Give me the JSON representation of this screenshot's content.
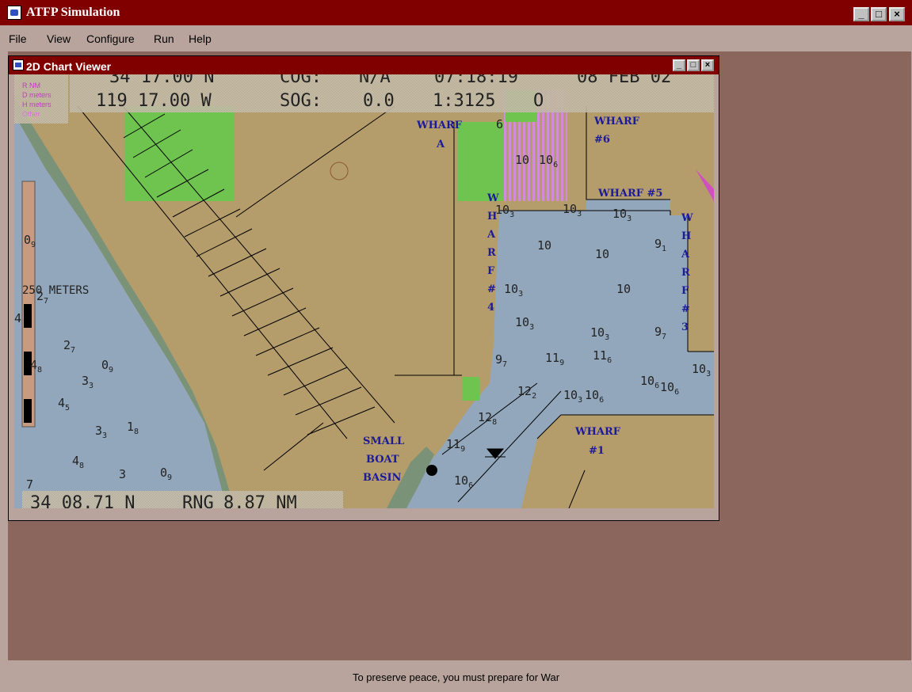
{
  "app": {
    "title": "ATFP Simulation",
    "window_controls": {
      "minimize": "_",
      "maximize": "□",
      "close": "×"
    }
  },
  "menu": {
    "items": [
      {
        "label": "File"
      },
      {
        "label": "View"
      },
      {
        "label": "Configure"
      },
      {
        "label": "Run"
      },
      {
        "label": "Help"
      }
    ]
  },
  "chart_viewer": {
    "title": "2D Chart Viewer",
    "window_controls": {
      "minimize": "_",
      "maximize": "□",
      "close": "×"
    },
    "readout": {
      "lat_top": "34 17.00 N",
      "lon": "119 17.00 W",
      "cog_label": "COG:",
      "cog_value": "N/A",
      "sog_label": "SOG:",
      "sog_value": "0.0",
      "time": "07:18:19",
      "date": "08 FEB 02",
      "scale": "1:3125",
      "scale_suffix": "O"
    },
    "legend": {
      "r": "R NM",
      "d": "D meters",
      "h": "H meters",
      "other": "Other"
    },
    "scale_bar_label": "250 METERS",
    "cursor_readout": {
      "lat": "34 08.71 N",
      "rng_label": "RNG",
      "rng_value": "8.87 NM"
    },
    "wharf_labels": {
      "a_line1": "WHARF",
      "a_line2": "A",
      "w6_line1": "WHARF",
      "w6_line2": "#6",
      "w5": "WHARF #5",
      "w4": [
        "W",
        "H",
        "A",
        "R",
        "F",
        "#",
        "4"
      ],
      "w3": [
        "W",
        "H",
        "A",
        "R",
        "F",
        "#",
        "3"
      ],
      "w1_line1": "WHARF",
      "w1_line2": "#1",
      "small_boat": [
        "SMALL",
        "BOAT",
        "BASIN"
      ]
    },
    "soundings": [
      {
        "t": "0",
        "s": "9"
      },
      {
        "t": "2",
        "s": "7"
      },
      {
        "t": "4",
        "s": ""
      },
      {
        "t": "2",
        "s": "7"
      },
      {
        "t": "4",
        "s": "8"
      },
      {
        "t": "0",
        "s": "9"
      },
      {
        "t": "3",
        "s": "3"
      },
      {
        "t": "4",
        "s": "5"
      },
      {
        "t": "3",
        "s": "3"
      },
      {
        "t": "1",
        "s": "8"
      },
      {
        "t": "4",
        "s": "8"
      },
      {
        "t": "3",
        "s": ""
      },
      {
        "t": "0",
        "s": "9"
      },
      {
        "t": "7",
        "s": ""
      },
      {
        "t": "6",
        "s": ""
      },
      {
        "t": "10",
        "s": ""
      },
      {
        "t": "10",
        "s": "6"
      },
      {
        "t": "10",
        "s": "3"
      },
      {
        "t": "10",
        "s": "3"
      },
      {
        "t": "10",
        "s": "3"
      },
      {
        "t": "10",
        "s": ""
      },
      {
        "t": "10",
        "s": ""
      },
      {
        "t": "9",
        "s": "1"
      },
      {
        "t": "10",
        "s": "3"
      },
      {
        "t": "10",
        "s": ""
      },
      {
        "t": "10",
        "s": "3"
      },
      {
        "t": "10",
        "s": "3"
      },
      {
        "t": "9",
        "s": "7"
      },
      {
        "t": "9",
        "s": "7"
      },
      {
        "t": "11",
        "s": "9"
      },
      {
        "t": "11",
        "s": "6"
      },
      {
        "t": "10",
        "s": "3"
      },
      {
        "t": "12",
        "s": "2"
      },
      {
        "t": "10",
        "s": "3"
      },
      {
        "t": "10",
        "s": "6"
      },
      {
        "t": "10",
        "s": "6"
      },
      {
        "t": "10",
        "s": "6"
      },
      {
        "t": "12",
        "s": "8"
      },
      {
        "t": "11",
        "s": "9"
      },
      {
        "t": "10",
        "s": "6"
      }
    ]
  },
  "status_bar": {
    "text": "To preserve peace, you must prepare for War"
  },
  "colors": {
    "land": "#b59c6b",
    "water": "#92a7bb",
    "green": "#6ec44e",
    "title_bar": "#800000",
    "desktop": "#8b665d",
    "label_blue": "#1a1a9a"
  }
}
